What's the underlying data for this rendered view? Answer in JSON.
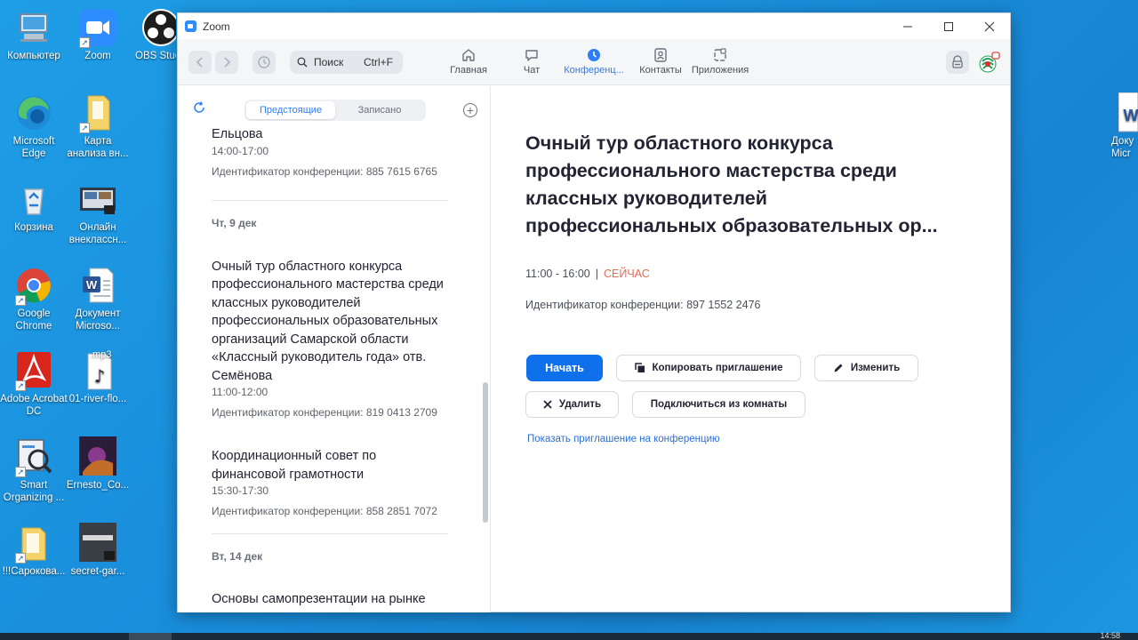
{
  "desktop": {
    "icons": [
      {
        "label": "Компьютер",
        "icon": "computer-icon"
      },
      {
        "label": "Zoom",
        "icon": "zoom-icon"
      },
      {
        "label": "OBS Stud",
        "icon": "obs-icon"
      },
      {
        "label": "Microsoft Edge",
        "icon": "edge-icon"
      },
      {
        "label": "Карта анализа вн...",
        "icon": "folder-icon"
      },
      {
        "label": "Корзина",
        "icon": "recycle-bin-icon"
      },
      {
        "label": "Онлайн внеклассн...",
        "icon": "video-file-icon"
      },
      {
        "label": "Google Chrome",
        "icon": "chrome-icon"
      },
      {
        "label": "Документ Microso...",
        "icon": "word-doc-icon"
      },
      {
        "label": "Adobe Acrobat DC",
        "icon": "acrobat-icon"
      },
      {
        "label": "01-river-flo...",
        "icon": "mp3-file-icon"
      },
      {
        "label": "Smart Organizing ...",
        "icon": "smart-organizing-icon"
      },
      {
        "label": "Ernesto_Co...",
        "icon": "image-file-icon"
      },
      {
        "label": "!!!Сарокова...",
        "icon": "folder-icon"
      },
      {
        "label": "secret-gar...",
        "icon": "video-file-icon"
      },
      {
        "label": "Доку Micr",
        "icon": "word-doc-icon"
      }
    ],
    "mp3_badge": ".mp3"
  },
  "window": {
    "title": "Zoom"
  },
  "toolbar": {
    "search_placeholder": "Поиск",
    "search_shortcut": "Ctrl+F",
    "tabs": [
      {
        "label": "Главная",
        "icon": "home-icon"
      },
      {
        "label": "Чат",
        "icon": "chat-icon"
      },
      {
        "label": "Конференц...",
        "icon": "clock-icon",
        "active": true
      },
      {
        "label": "Контакты",
        "icon": "contacts-icon"
      },
      {
        "label": "Приложения",
        "icon": "apps-icon"
      }
    ]
  },
  "left_panel": {
    "segments": [
      "Предстоящие",
      "Записано"
    ],
    "meetings_top": {
      "title": "Ельцова",
      "time": "14:00-17:00",
      "id": "Идентификатор конференции: 885 7615 6765"
    },
    "day1": "Чт, 9 дек",
    "meeting_a": {
      "title_lines": [
        "Очный тур областного конкурса",
        "профессионального мастерства среди",
        "классных руководителей",
        "профессиональных образовательных",
        "организаций Самарской области",
        "«Классный руководитель года» отв.",
        "Семёнова"
      ],
      "time": "11:00-12:00",
      "id": "Идентификатор конференции: 819 0413 2709"
    },
    "meeting_b": {
      "title_lines": [
        "Координационный совет по",
        "финансовой грамотности"
      ],
      "time": "15:30-17:30",
      "id": "Идентификатор конференции: 858 2851 7072"
    },
    "day2": "Вт, 14 дек",
    "meeting_c": {
      "title": "Основы самопрезентации на рынке"
    }
  },
  "detail": {
    "title_lines": [
      "Очный тур областного конкурса",
      "профессионального мастерства среди",
      "классных руководителей",
      "профессиональных образовательных ор..."
    ],
    "time": "11:00 - 16:00",
    "separator": "|",
    "status": "СЕЙЧАС",
    "id": "Идентификатор конференции: 897 1552 2476",
    "buttons": {
      "start": "Начать",
      "copy": "Копировать приглашение",
      "edit": "Изменить",
      "delete": "Удалить",
      "join_room": "Подключиться из комнаты"
    },
    "show_invite": "Показать приглашение на конференцию"
  },
  "taskbar": {
    "clock": "14:58"
  }
}
